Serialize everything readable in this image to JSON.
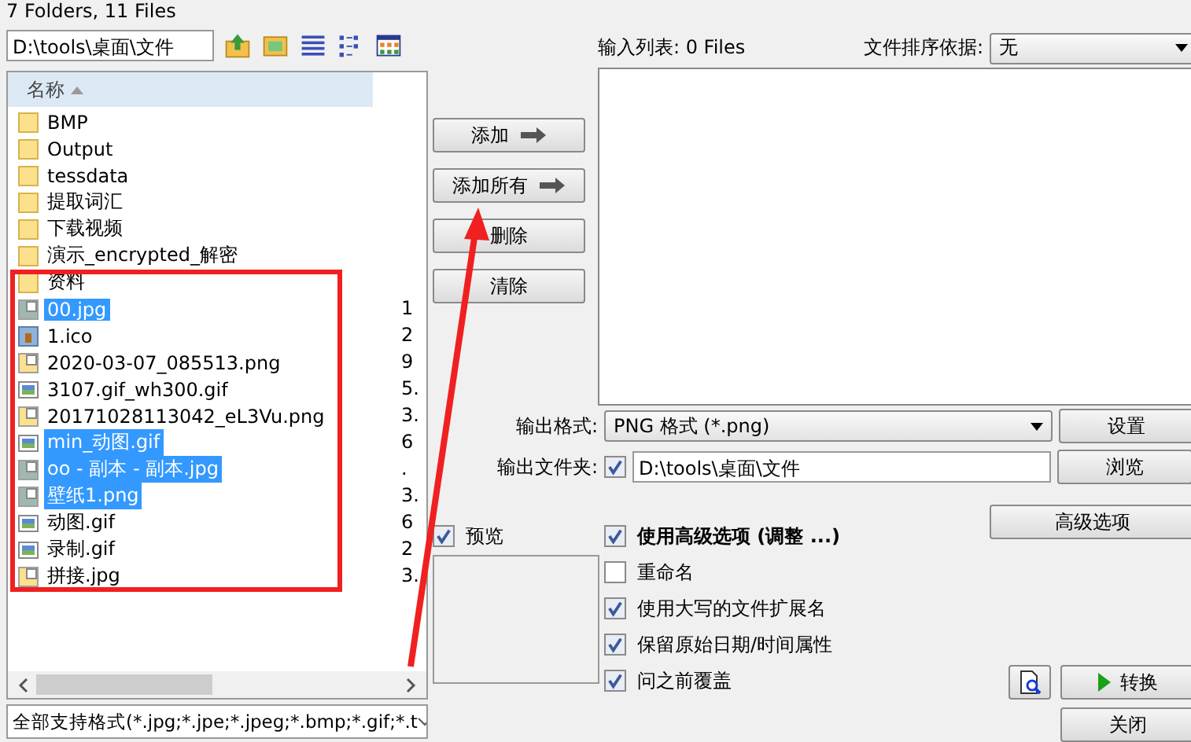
{
  "status": "7 Folders, 11 Files",
  "path": "D:\\tools\\桌面\\文件",
  "list_header": "名称",
  "files": [
    {
      "name": "BMP",
      "kind": "folder",
      "selected": false
    },
    {
      "name": "Output",
      "kind": "folder",
      "selected": false
    },
    {
      "name": "tessdata",
      "kind": "folder",
      "selected": false
    },
    {
      "name": "提取词汇",
      "kind": "folder",
      "selected": false
    },
    {
      "name": "下载视频",
      "kind": "folder",
      "selected": false
    },
    {
      "name": "演示_encrypted_解密",
      "kind": "folder",
      "selected": false
    },
    {
      "name": "资料",
      "kind": "folder",
      "selected": false
    },
    {
      "name": "00.jpg",
      "kind": "image",
      "size": "1",
      "selected": true
    },
    {
      "name": "1.ico",
      "kind": "ico",
      "size": "2",
      "selected": false
    },
    {
      "name": "2020-03-07_085513.png",
      "kind": "image",
      "size": "9",
      "selected": false
    },
    {
      "name": "3107.gif_wh300.gif",
      "kind": "gif",
      "size": "5.",
      "selected": false
    },
    {
      "name": "20171028113042_eL3Vu.png",
      "kind": "image",
      "size": "3.",
      "selected": false
    },
    {
      "name": "min_动图.gif",
      "kind": "gif",
      "size": "6",
      "selected": true
    },
    {
      "name": "oo - 副本 - 副本.jpg",
      "kind": "image",
      "size": ".",
      "selected": true
    },
    {
      "name": "壁纸1.png",
      "kind": "image",
      "size": "3.",
      "selected": true
    },
    {
      "name": "动图.gif",
      "kind": "gif",
      "size": "6",
      "selected": false
    },
    {
      "name": "录制.gif",
      "kind": "gif",
      "size": "2",
      "selected": false
    },
    {
      "name": "拼接.jpg",
      "kind": "image",
      "size": "3.",
      "selected": false
    }
  ],
  "filter": "全部支持格式(*.jpg;*.jpe;*.jpeg;*.bmp;*.gif;*.t",
  "list_buttons": [
    {
      "label": "添加",
      "arrow": true
    },
    {
      "label": "添加所有",
      "arrow": true
    },
    {
      "label": "删除",
      "arrow": false
    },
    {
      "label": "清除",
      "arrow": false
    }
  ],
  "input_list": {
    "label": "输入列表:",
    "count": "0 Files"
  },
  "sort": {
    "label": "文件排序依据:",
    "value": "无"
  },
  "output_format": {
    "label": "输出格式:",
    "value": "PNG 格式 (*.png)",
    "button": "设置"
  },
  "output_folder": {
    "label": "输出文件夹:",
    "checked": true,
    "value": "D:\\tools\\桌面\\文件",
    "button": "浏览"
  },
  "preview": {
    "label": "预览",
    "checked": true
  },
  "options": [
    {
      "label": "使用高级选项 (调整 ...)",
      "checked": true,
      "bold": true
    },
    {
      "label": "重命名",
      "checked": false,
      "bold": false
    },
    {
      "label": "使用大写的文件扩展名",
      "checked": true,
      "bold": false
    },
    {
      "label": "保留原始日期/时间属性",
      "checked": true,
      "bold": false
    },
    {
      "label": "问之前覆盖",
      "checked": true,
      "bold": false
    }
  ],
  "advanced_button": "高级选项",
  "convert_button": "转换",
  "close_button": "关闭"
}
